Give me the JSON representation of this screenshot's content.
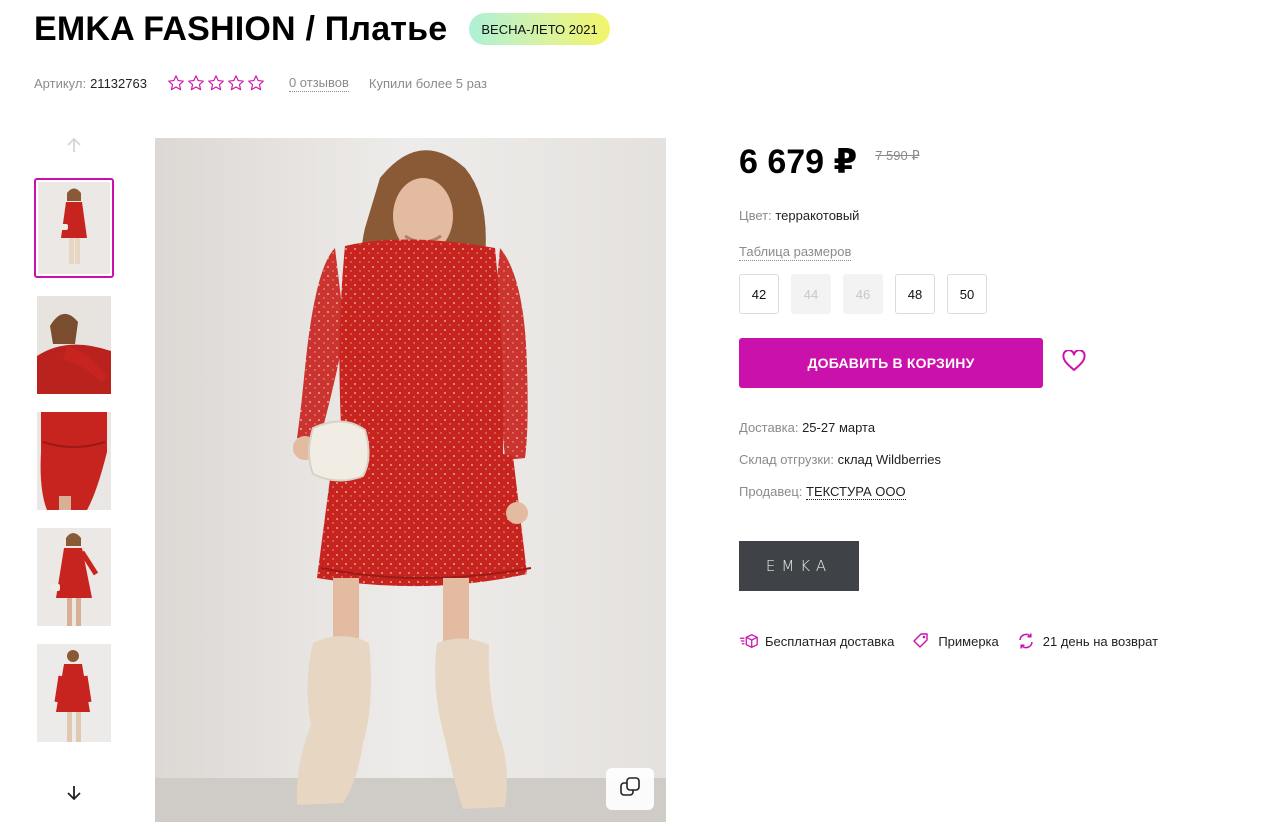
{
  "product": {
    "title": "EMKA FASHION / Платье",
    "season_badge": "ВЕСНА-ЛЕТО 2021",
    "sku_label": "Артикул:",
    "sku": "21132763",
    "rating_stars": 0,
    "reviews_text": "0 отзывов",
    "bought_text": "Купили более 5 раз"
  },
  "gallery": {
    "thumb_count": 5,
    "active_index": 0
  },
  "pricing": {
    "price": "6 679 ₽",
    "old_price": "7 590 ₽"
  },
  "color": {
    "label": "Цвет:",
    "value": "терракотовый"
  },
  "size_table_link": "Таблица размеров",
  "sizes": [
    {
      "label": "42",
      "available": true
    },
    {
      "label": "44",
      "available": false
    },
    {
      "label": "46",
      "available": false
    },
    {
      "label": "48",
      "available": true
    },
    {
      "label": "50",
      "available": true
    }
  ],
  "cart": {
    "button_label": "ДОБАВИТЬ В КОРЗИНУ"
  },
  "delivery": {
    "label": "Доставка:",
    "value": "25-27 марта"
  },
  "warehouse": {
    "label": "Склад отгрузки:",
    "value": "склад Wildberries"
  },
  "seller": {
    "label": "Продавец:",
    "value": "ТЕКСТУРА ООО"
  },
  "brand_logo_text": "EMKA",
  "features": [
    {
      "icon": "delivery-box-icon",
      "label": "Бесплатная доставка"
    },
    {
      "icon": "tag-icon",
      "label": "Примерка"
    },
    {
      "icon": "refresh-icon",
      "label": "21 день на возврат"
    }
  ],
  "colors": {
    "accent": "#cb11ab",
    "dress": "#c8241f",
    "boots": "#e6d6c2",
    "muted_text": "#8b8b8b"
  }
}
